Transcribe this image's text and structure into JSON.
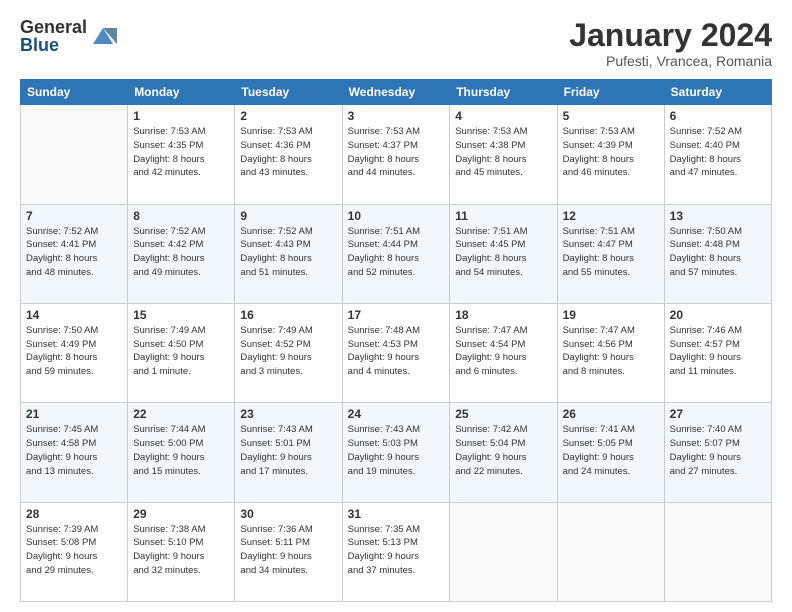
{
  "header": {
    "logo_general": "General",
    "logo_blue": "Blue",
    "month_title": "January 2024",
    "subtitle": "Pufesti, Vrancea, Romania"
  },
  "weekdays": [
    "Sunday",
    "Monday",
    "Tuesday",
    "Wednesday",
    "Thursday",
    "Friday",
    "Saturday"
  ],
  "weeks": [
    [
      {
        "day": "",
        "info": ""
      },
      {
        "day": "1",
        "info": "Sunrise: 7:53 AM\nSunset: 4:35 PM\nDaylight: 8 hours\nand 42 minutes."
      },
      {
        "day": "2",
        "info": "Sunrise: 7:53 AM\nSunset: 4:36 PM\nDaylight: 8 hours\nand 43 minutes."
      },
      {
        "day": "3",
        "info": "Sunrise: 7:53 AM\nSunset: 4:37 PM\nDaylight: 8 hours\nand 44 minutes."
      },
      {
        "day": "4",
        "info": "Sunrise: 7:53 AM\nSunset: 4:38 PM\nDaylight: 8 hours\nand 45 minutes."
      },
      {
        "day": "5",
        "info": "Sunrise: 7:53 AM\nSunset: 4:39 PM\nDaylight: 8 hours\nand 46 minutes."
      },
      {
        "day": "6",
        "info": "Sunrise: 7:52 AM\nSunset: 4:40 PM\nDaylight: 8 hours\nand 47 minutes."
      }
    ],
    [
      {
        "day": "7",
        "info": "Sunrise: 7:52 AM\nSunset: 4:41 PM\nDaylight: 8 hours\nand 48 minutes."
      },
      {
        "day": "8",
        "info": "Sunrise: 7:52 AM\nSunset: 4:42 PM\nDaylight: 8 hours\nand 49 minutes."
      },
      {
        "day": "9",
        "info": "Sunrise: 7:52 AM\nSunset: 4:43 PM\nDaylight: 8 hours\nand 51 minutes."
      },
      {
        "day": "10",
        "info": "Sunrise: 7:51 AM\nSunset: 4:44 PM\nDaylight: 8 hours\nand 52 minutes."
      },
      {
        "day": "11",
        "info": "Sunrise: 7:51 AM\nSunset: 4:45 PM\nDaylight: 8 hours\nand 54 minutes."
      },
      {
        "day": "12",
        "info": "Sunrise: 7:51 AM\nSunset: 4:47 PM\nDaylight: 8 hours\nand 55 minutes."
      },
      {
        "day": "13",
        "info": "Sunrise: 7:50 AM\nSunset: 4:48 PM\nDaylight: 8 hours\nand 57 minutes."
      }
    ],
    [
      {
        "day": "14",
        "info": "Sunrise: 7:50 AM\nSunset: 4:49 PM\nDaylight: 8 hours\nand 59 minutes."
      },
      {
        "day": "15",
        "info": "Sunrise: 7:49 AM\nSunset: 4:50 PM\nDaylight: 9 hours\nand 1 minute."
      },
      {
        "day": "16",
        "info": "Sunrise: 7:49 AM\nSunset: 4:52 PM\nDaylight: 9 hours\nand 3 minutes."
      },
      {
        "day": "17",
        "info": "Sunrise: 7:48 AM\nSunset: 4:53 PM\nDaylight: 9 hours\nand 4 minutes."
      },
      {
        "day": "18",
        "info": "Sunrise: 7:47 AM\nSunset: 4:54 PM\nDaylight: 9 hours\nand 6 minutes."
      },
      {
        "day": "19",
        "info": "Sunrise: 7:47 AM\nSunset: 4:56 PM\nDaylight: 9 hours\nand 8 minutes."
      },
      {
        "day": "20",
        "info": "Sunrise: 7:46 AM\nSunset: 4:57 PM\nDaylight: 9 hours\nand 11 minutes."
      }
    ],
    [
      {
        "day": "21",
        "info": "Sunrise: 7:45 AM\nSunset: 4:58 PM\nDaylight: 9 hours\nand 13 minutes."
      },
      {
        "day": "22",
        "info": "Sunrise: 7:44 AM\nSunset: 5:00 PM\nDaylight: 9 hours\nand 15 minutes."
      },
      {
        "day": "23",
        "info": "Sunrise: 7:43 AM\nSunset: 5:01 PM\nDaylight: 9 hours\nand 17 minutes."
      },
      {
        "day": "24",
        "info": "Sunrise: 7:43 AM\nSunset: 5:03 PM\nDaylight: 9 hours\nand 19 minutes."
      },
      {
        "day": "25",
        "info": "Sunrise: 7:42 AM\nSunset: 5:04 PM\nDaylight: 9 hours\nand 22 minutes."
      },
      {
        "day": "26",
        "info": "Sunrise: 7:41 AM\nSunset: 5:05 PM\nDaylight: 9 hours\nand 24 minutes."
      },
      {
        "day": "27",
        "info": "Sunrise: 7:40 AM\nSunset: 5:07 PM\nDaylight: 9 hours\nand 27 minutes."
      }
    ],
    [
      {
        "day": "28",
        "info": "Sunrise: 7:39 AM\nSunset: 5:08 PM\nDaylight: 9 hours\nand 29 minutes."
      },
      {
        "day": "29",
        "info": "Sunrise: 7:38 AM\nSunset: 5:10 PM\nDaylight: 9 hours\nand 32 minutes."
      },
      {
        "day": "30",
        "info": "Sunrise: 7:36 AM\nSunset: 5:11 PM\nDaylight: 9 hours\nand 34 minutes."
      },
      {
        "day": "31",
        "info": "Sunrise: 7:35 AM\nSunset: 5:13 PM\nDaylight: 9 hours\nand 37 minutes."
      },
      {
        "day": "",
        "info": ""
      },
      {
        "day": "",
        "info": ""
      },
      {
        "day": "",
        "info": ""
      }
    ]
  ]
}
